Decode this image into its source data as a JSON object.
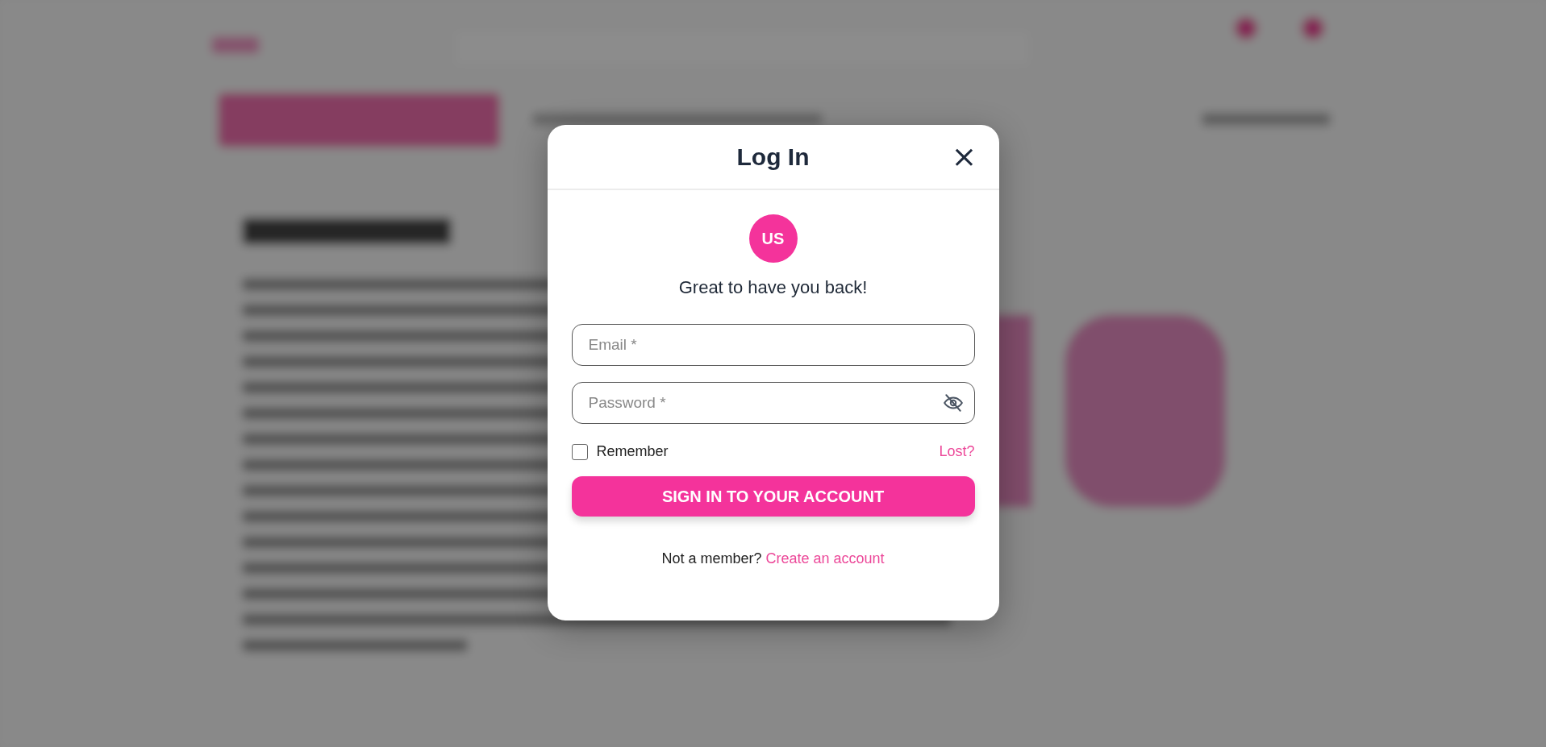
{
  "dialog": {
    "title": "Log In",
    "close": "×",
    "avatar": "US",
    "greeting": "Great to have you back!",
    "fields": [
      {
        "kind": "email",
        "placeholder": "Email *"
      },
      {
        "kind": "password",
        "placeholder": "Password *"
      }
    ],
    "remember": {
      "label": "Remember",
      "checked": false
    },
    "lost_link": "Lost?",
    "submit": "SIGN IN TO YOUR ACCOUNT",
    "footer": {
      "text": "Not a member?",
      "link": "Create an account"
    }
  }
}
